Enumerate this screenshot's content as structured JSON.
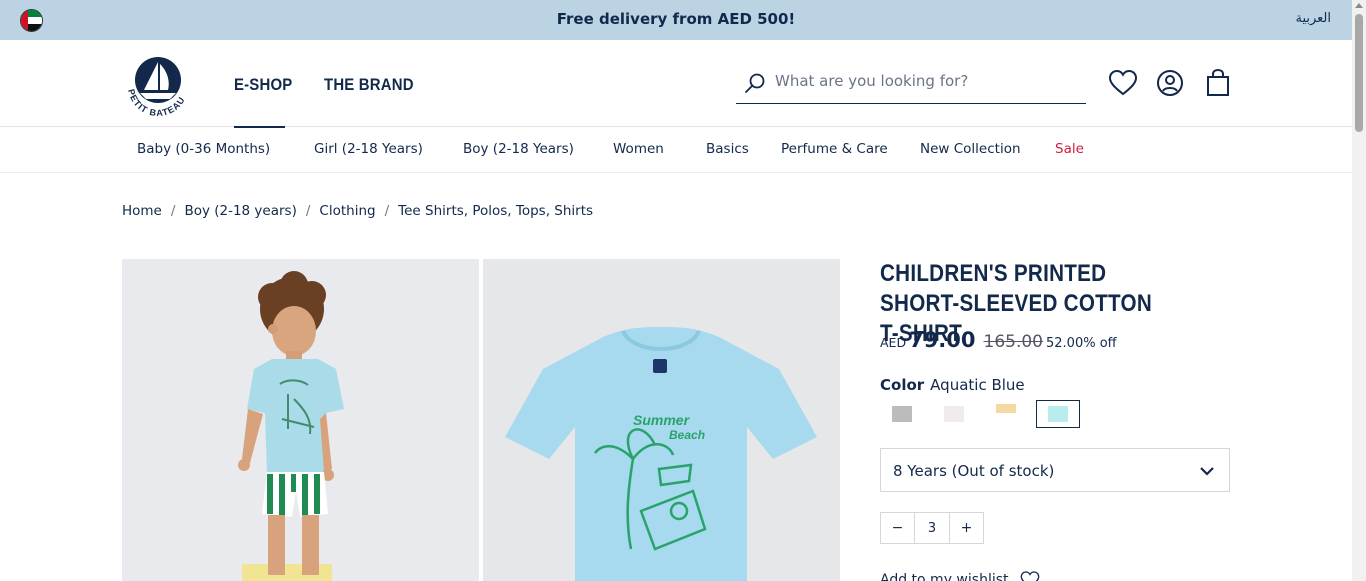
{
  "topbar": {
    "promo": "Free delivery from AED 500!",
    "language": "العربية",
    "flag_icon": "uae-flag-icon"
  },
  "header": {
    "logo_icon": "petit-bateau-logo",
    "logo_text": "PETIT BATEAU",
    "nav": [
      {
        "label": "E-SHOP",
        "active": true
      },
      {
        "label": "THE BRAND",
        "active": false
      }
    ],
    "search": {
      "placeholder": "What are you looking for?",
      "value": ""
    },
    "icons": [
      "heart-icon",
      "user-icon",
      "shopping-bag-icon"
    ]
  },
  "categories": [
    {
      "label": "Baby (0-36 Months)"
    },
    {
      "label": "Girl (2-18 Years)"
    },
    {
      "label": "Boy (2-18 Years)"
    },
    {
      "label": "Women"
    },
    {
      "label": "Basics"
    },
    {
      "label": "Perfume & Care"
    },
    {
      "label": "New Collection"
    },
    {
      "label": "Sale"
    }
  ],
  "breadcrumb": [
    {
      "label": "Home"
    },
    {
      "label": "Boy (2-18 years)"
    },
    {
      "label": "Clothing"
    },
    {
      "label": "Tee Shirts, Polos, Tops, Shirts"
    }
  ],
  "product": {
    "title": "CHILDREN'S PRINTED SHORT-SLEEVED COTTON T-SHIRT",
    "currency": "AED",
    "price": "79.00",
    "old_price": "165.00",
    "discount": "52.00% off",
    "color_label": "Color",
    "color_value": "Aquatic Blue",
    "swatches": [
      {
        "name": "grey",
        "hex": "#bdbbbb",
        "selected": false
      },
      {
        "name": "white",
        "hex": "#efeceb",
        "selected": false
      },
      {
        "name": "yellow",
        "hex": "#f5d9a3",
        "selected": false
      },
      {
        "name": "aquatic-blue",
        "hex": "#b8ecef",
        "selected": true
      }
    ],
    "size": "8 Years (Out of stock)",
    "quantity": "3",
    "qty_minus": "−",
    "qty_plus": "+",
    "wishlist_label": "Add to my wishlist"
  },
  "colors": {
    "topbar_bg": "#bcd3e4",
    "navy": "#13294b",
    "sale": "#d0203f"
  }
}
